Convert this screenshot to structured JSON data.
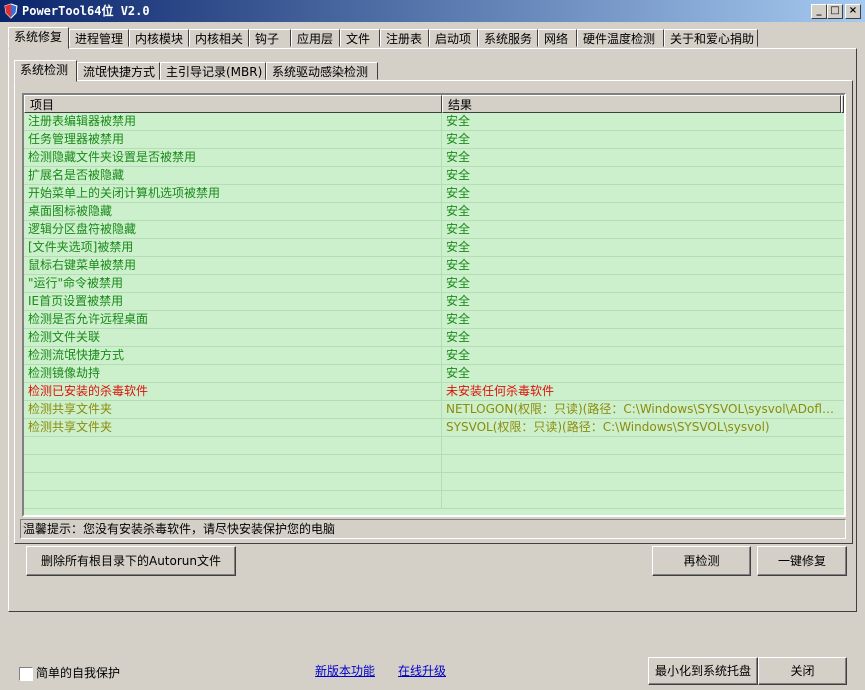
{
  "window": {
    "title": "PowerTool64位 V2.0",
    "minimize": "_",
    "maximize": "□",
    "close": "×"
  },
  "tabs": [
    "系统修复",
    "进程管理",
    "内核模块",
    "内核相关",
    "钩子",
    "应用层",
    "文件",
    "注册表",
    "启动项",
    "系统服务",
    "网络",
    "硬件温度检测",
    "关于和爱心捐助"
  ],
  "subtabs": [
    "系统检测",
    "流氓快捷方式",
    "主引导记录(MBR)",
    "系统驱动感染检测"
  ],
  "list": {
    "columns": [
      "项目",
      "结果"
    ],
    "rows": [
      {
        "item": "注册表编辑器被禁用",
        "result": "安全",
        "status": "ok"
      },
      {
        "item": "任务管理器被禁用",
        "result": "安全",
        "status": "ok"
      },
      {
        "item": "检测隐藏文件夹设置是否被禁用",
        "result": "安全",
        "status": "ok"
      },
      {
        "item": "扩展名是否被隐藏",
        "result": "安全",
        "status": "ok"
      },
      {
        "item": "开始菜单上的关闭计算机选项被禁用",
        "result": "安全",
        "status": "ok"
      },
      {
        "item": "桌面图标被隐藏",
        "result": "安全",
        "status": "ok"
      },
      {
        "item": "逻辑分区盘符被隐藏",
        "result": "安全",
        "status": "ok"
      },
      {
        "item": "[文件夹选项]被禁用",
        "result": "安全",
        "status": "ok"
      },
      {
        "item": "鼠标右键菜单被禁用",
        "result": "安全",
        "status": "ok"
      },
      {
        "item": "\"运行\"命令被禁用",
        "result": "安全",
        "status": "ok"
      },
      {
        "item": "IE首页设置被禁用",
        "result": "安全",
        "status": "ok"
      },
      {
        "item": "检测是否允许远程桌面",
        "result": "安全",
        "status": "ok"
      },
      {
        "item": "检测文件关联",
        "result": "安全",
        "status": "ok"
      },
      {
        "item": "检测流氓快捷方式",
        "result": "安全",
        "status": "ok"
      },
      {
        "item": "检测镜像劫持",
        "result": "安全",
        "status": "ok"
      },
      {
        "item": "检测已安装的杀毒软件",
        "result": "未安装任何杀毒软件",
        "status": "warn"
      },
      {
        "item": "检测共享文件夹",
        "result": "NETLOGON(权限：只读)(路径：C:\\Windows\\SYSVOL\\sysvol\\ADoflm...",
        "status": "info"
      },
      {
        "item": "检测共享文件夹",
        "result": "SYSVOL(权限：只读)(路径：C:\\Windows\\SYSVOL\\sysvol)",
        "status": "info"
      }
    ]
  },
  "status_text": "温馨提示：您没有安装杀毒软件，请尽快安装保护您的电脑",
  "buttons": {
    "delete_autorun": "删除所有根目录下的Autorun文件",
    "recheck": "再检测",
    "one_click_fix": "一键修复",
    "minimize_tray": "最小化到系统托盘",
    "close": "关闭"
  },
  "footer": {
    "self_protect": "简单的自我保护",
    "new_features": "新版本功能",
    "online_upgrade": "在线升级"
  },
  "colors": {
    "ok": "#1a8a1a",
    "warn": "#e0100a",
    "info": "#8c8c0a",
    "row_bg": "#ccf0cc",
    "title_start": "#0a246a"
  }
}
